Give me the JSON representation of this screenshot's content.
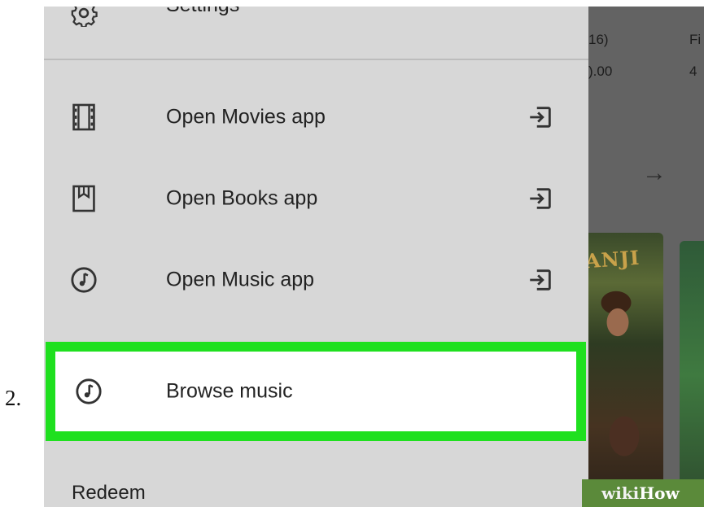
{
  "step_label": "2.",
  "background_app": {
    "col1_line1": "16)",
    "col1_line2": ").00",
    "col2_line1": "Fi",
    "col2_line2": "4",
    "poster_title": "ANJI"
  },
  "drawer": {
    "settings_label": "Settings",
    "items": [
      {
        "label": "Open Movies app",
        "icon": "film-icon"
      },
      {
        "label": "Open Books app",
        "icon": "bookmark-book-icon"
      },
      {
        "label": "Open Music app",
        "icon": "music-note-icon"
      }
    ],
    "highlighted_item": {
      "label": "Browse music",
      "icon": "music-note-icon"
    },
    "redeem_label": "Redeem"
  },
  "watermark": {
    "part1": "wiki",
    "part2": "How"
  },
  "colors": {
    "highlight": "#1fe01f",
    "drawer_bg": "#d7d7d7",
    "scrim": "#636363"
  }
}
